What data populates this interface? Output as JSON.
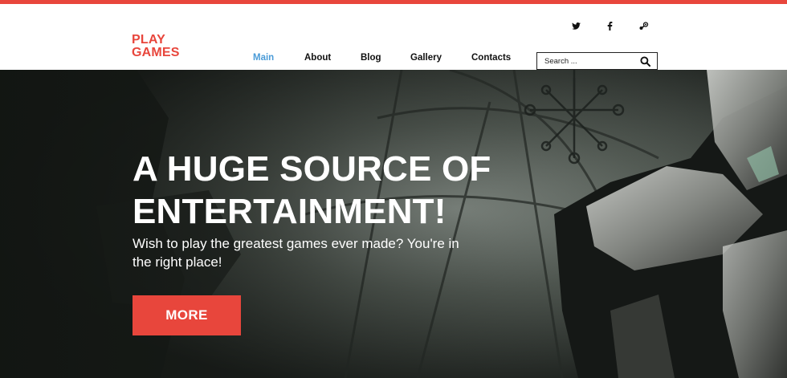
{
  "brand": {
    "line1": "PLAY",
    "line2": "GAMES",
    "accent_color": "#e8463c"
  },
  "social": [
    {
      "icon": "twitter-icon"
    },
    {
      "icon": "facebook-icon"
    },
    {
      "icon": "steam-icon"
    }
  ],
  "nav": {
    "items": [
      {
        "label": "Main",
        "active": true
      },
      {
        "label": "About",
        "active": false
      },
      {
        "label": "Blog",
        "active": false
      },
      {
        "label": "Gallery",
        "active": false
      },
      {
        "label": "Contacts",
        "active": false
      }
    ],
    "active_color": "#4a9bd8"
  },
  "search": {
    "placeholder": "Search ...",
    "icon": "search-icon"
  },
  "hero": {
    "title_line1": "A HUGE SOURCE OF",
    "title_line2": "ENTERTAINMENT!",
    "subtitle": "Wish to play the greatest games ever made? You're in the right place!",
    "button_label": "MORE"
  }
}
